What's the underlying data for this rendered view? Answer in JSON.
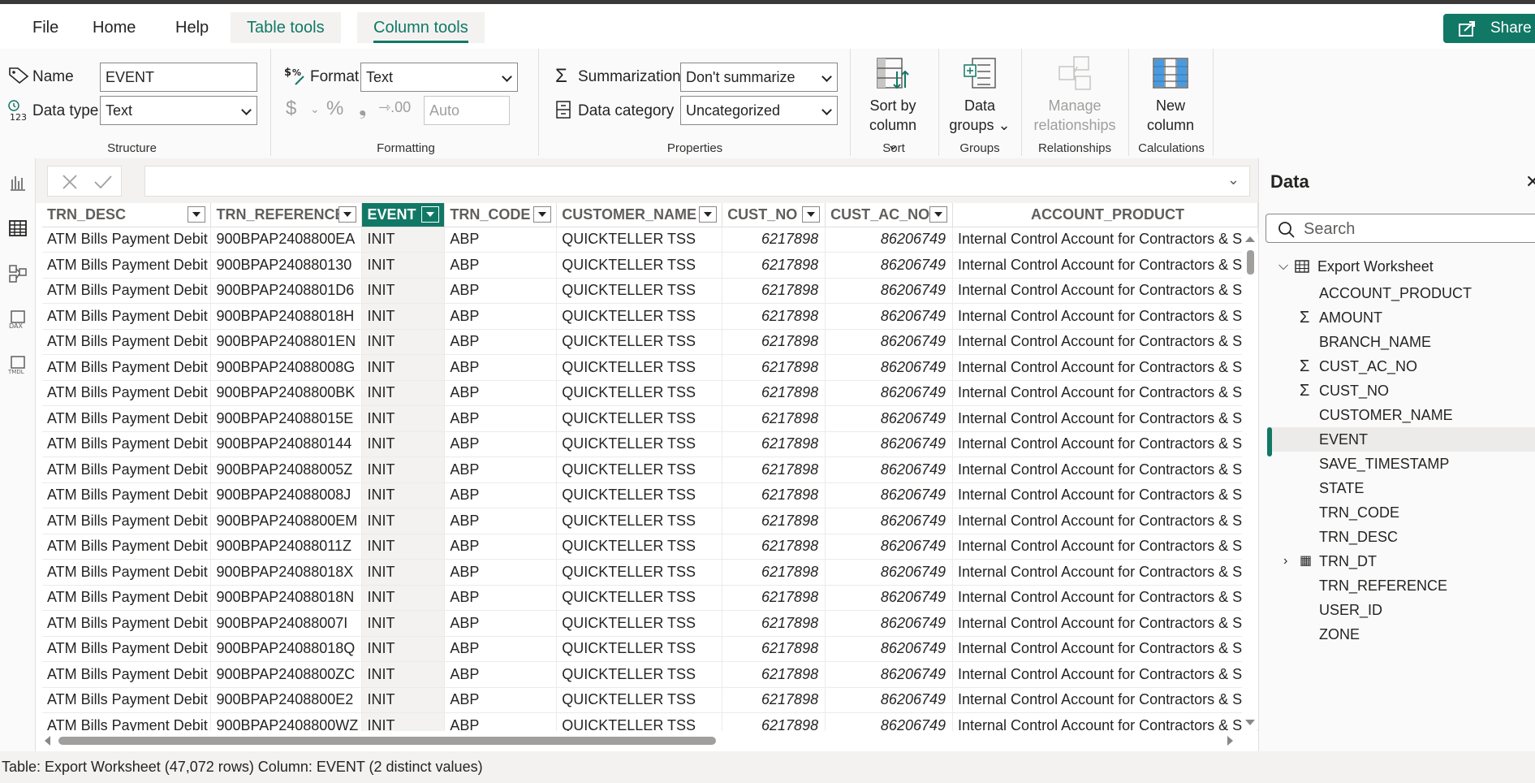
{
  "menu": {
    "tabs": [
      "File",
      "Home",
      "Help",
      "Table tools",
      "Column tools"
    ],
    "share_label": "Share"
  },
  "ribbon": {
    "structure": {
      "name_label": "Name",
      "name_value": "EVENT",
      "datatype_label": "Data type",
      "datatype_value": "Text",
      "group_label": "Structure"
    },
    "formatting": {
      "format_label": "Format",
      "format_value": "Text",
      "decimals_placeholder": "Auto",
      "group_label": "Formatting"
    },
    "properties": {
      "summarization_label": "Summarization",
      "summarization_value": "Don't summarize",
      "category_label": "Data category",
      "category_value": "Uncategorized",
      "group_label": "Properties"
    },
    "sort": {
      "line1": "Sort by",
      "line2": "column",
      "group_label": "Sort"
    },
    "groups": {
      "line1": "Data",
      "line2": "groups",
      "group_label": "Groups"
    },
    "relationships": {
      "line1": "Manage",
      "line2": "relationships",
      "group_label": "Relationships"
    },
    "calculations": {
      "line1": "New",
      "line2": "column",
      "group_label": "Calculations"
    }
  },
  "grid": {
    "columns": [
      "TRN_DESC",
      "TRN_REFERENCE",
      "EVENT",
      "TRN_CODE",
      "CUSTOMER_NAME",
      "CUST_NO",
      "CUST_AC_NO",
      "ACCOUNT_PRODUCT"
    ],
    "selected_column": "EVENT",
    "rows": [
      [
        "ATM Bills Payment Debit",
        "900BPAP2408800EA",
        "INIT",
        "ABP",
        "QUICKTELLER TSS",
        "6217898",
        "86206749",
        "Internal Control Account for Contractors & S"
      ],
      [
        "ATM Bills Payment Debit",
        "900BPAP240880130",
        "INIT",
        "ABP",
        "QUICKTELLER TSS",
        "6217898",
        "86206749",
        "Internal Control Account for Contractors & S"
      ],
      [
        "ATM Bills Payment Debit",
        "900BPAP2408801D6",
        "INIT",
        "ABP",
        "QUICKTELLER TSS",
        "6217898",
        "86206749",
        "Internal Control Account for Contractors & S"
      ],
      [
        "ATM Bills Payment Debit",
        "900BPAP24088018H",
        "INIT",
        "ABP",
        "QUICKTELLER TSS",
        "6217898",
        "86206749",
        "Internal Control Account for Contractors & S"
      ],
      [
        "ATM Bills Payment Debit",
        "900BPAP2408801EN",
        "INIT",
        "ABP",
        "QUICKTELLER TSS",
        "6217898",
        "86206749",
        "Internal Control Account for Contractors & S"
      ],
      [
        "ATM Bills Payment Debit",
        "900BPAP24088008G",
        "INIT",
        "ABP",
        "QUICKTELLER TSS",
        "6217898",
        "86206749",
        "Internal Control Account for Contractors & S"
      ],
      [
        "ATM Bills Payment Debit",
        "900BPAP2408800BK",
        "INIT",
        "ABP",
        "QUICKTELLER TSS",
        "6217898",
        "86206749",
        "Internal Control Account for Contractors & S"
      ],
      [
        "ATM Bills Payment Debit",
        "900BPAP24088015E",
        "INIT",
        "ABP",
        "QUICKTELLER TSS",
        "6217898",
        "86206749",
        "Internal Control Account for Contractors & S"
      ],
      [
        "ATM Bills Payment Debit",
        "900BPAP240880144",
        "INIT",
        "ABP",
        "QUICKTELLER TSS",
        "6217898",
        "86206749",
        "Internal Control Account for Contractors & S"
      ],
      [
        "ATM Bills Payment Debit",
        "900BPAP24088005Z",
        "INIT",
        "ABP",
        "QUICKTELLER TSS",
        "6217898",
        "86206749",
        "Internal Control Account for Contractors & S"
      ],
      [
        "ATM Bills Payment Debit",
        "900BPAP24088008J",
        "INIT",
        "ABP",
        "QUICKTELLER TSS",
        "6217898",
        "86206749",
        "Internal Control Account for Contractors & S"
      ],
      [
        "ATM Bills Payment Debit",
        "900BPAP2408800EM",
        "INIT",
        "ABP",
        "QUICKTELLER TSS",
        "6217898",
        "86206749",
        "Internal Control Account for Contractors & S"
      ],
      [
        "ATM Bills Payment Debit",
        "900BPAP24088011Z",
        "INIT",
        "ABP",
        "QUICKTELLER TSS",
        "6217898",
        "86206749",
        "Internal Control Account for Contractors & S"
      ],
      [
        "ATM Bills Payment Debit",
        "900BPAP24088018X",
        "INIT",
        "ABP",
        "QUICKTELLER TSS",
        "6217898",
        "86206749",
        "Internal Control Account for Contractors & S"
      ],
      [
        "ATM Bills Payment Debit",
        "900BPAP24088018N",
        "INIT",
        "ABP",
        "QUICKTELLER TSS",
        "6217898",
        "86206749",
        "Internal Control Account for Contractors & S"
      ],
      [
        "ATM Bills Payment Debit",
        "900BPAP24088007I",
        "INIT",
        "ABP",
        "QUICKTELLER TSS",
        "6217898",
        "86206749",
        "Internal Control Account for Contractors & S"
      ],
      [
        "ATM Bills Payment Debit",
        "900BPAP24088018Q",
        "INIT",
        "ABP",
        "QUICKTELLER TSS",
        "6217898",
        "86206749",
        "Internal Control Account for Contractors & S"
      ],
      [
        "ATM Bills Payment Debit",
        "900BPAP2408800ZC",
        "INIT",
        "ABP",
        "QUICKTELLER TSS",
        "6217898",
        "86206749",
        "Internal Control Account for Contractors & S"
      ],
      [
        "ATM Bills Payment Debit",
        "900BPAP2408800E2",
        "INIT",
        "ABP",
        "QUICKTELLER TSS",
        "6217898",
        "86206749",
        "Internal Control Account for Contractors & S"
      ],
      [
        "ATM Bills Payment Debit",
        "900BPAP2408800WZ",
        "INIT",
        "ABP",
        "QUICKTELLER TSS",
        "6217898",
        "86206749",
        "Internal Control Account for Contractors & S"
      ]
    ]
  },
  "status": {
    "text": "Table: Export Worksheet (47,072 rows) Column: EVENT (2 distinct values)"
  },
  "data_pane": {
    "title": "Data",
    "search_placeholder": "Search",
    "table_name": "Export Worksheet",
    "fields": [
      {
        "name": "ACCOUNT_PRODUCT",
        "sigma": false
      },
      {
        "name": "AMOUNT",
        "sigma": true
      },
      {
        "name": "BRANCH_NAME",
        "sigma": false
      },
      {
        "name": "CUST_AC_NO",
        "sigma": true
      },
      {
        "name": "CUST_NO",
        "sigma": true
      },
      {
        "name": "CUSTOMER_NAME",
        "sigma": false
      },
      {
        "name": "EVENT",
        "sigma": false,
        "selected": true
      },
      {
        "name": "SAVE_TIMESTAMP",
        "sigma": false
      },
      {
        "name": "STATE",
        "sigma": false
      },
      {
        "name": "TRN_CODE",
        "sigma": false
      },
      {
        "name": "TRN_DESC",
        "sigma": false
      },
      {
        "name": "TRN_DT",
        "sigma": false,
        "expandable": true
      },
      {
        "name": "TRN_REFERENCE",
        "sigma": false
      },
      {
        "name": "USER_ID",
        "sigma": false
      },
      {
        "name": "ZONE",
        "sigma": false
      }
    ]
  },
  "colors": {
    "accent": "#117865",
    "selected_column_bg": "#f3f2f1"
  }
}
